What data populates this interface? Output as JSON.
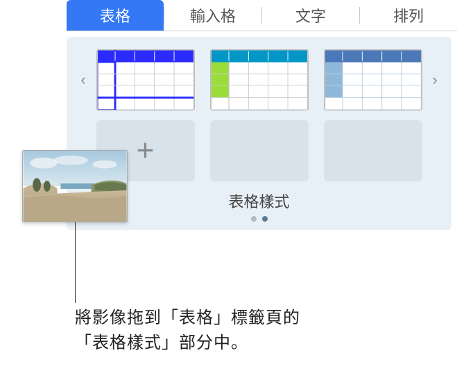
{
  "tabs": {
    "table": "表格",
    "cell": "輸入格",
    "text": "文字",
    "arrange": "排列"
  },
  "styles": {
    "section_title": "表格樣式",
    "add_symbol": "+",
    "nav_left": "‹",
    "nav_right": "›"
  },
  "pagination": {
    "pages": 2,
    "current": 1
  },
  "callout": {
    "line1": "將影像拖到「表格」標籤頁的",
    "line2": "「表格樣式」部分中。"
  },
  "thumbnails": {
    "style1": {
      "header_color": "#2b2bff",
      "accent_color": "#2b2bff"
    },
    "style2": {
      "header_color": "#0097c7",
      "accent_color": "#9add3a"
    },
    "style3": {
      "header_color": "#4a78b8",
      "accent_color": "#8fb8d8"
    }
  }
}
